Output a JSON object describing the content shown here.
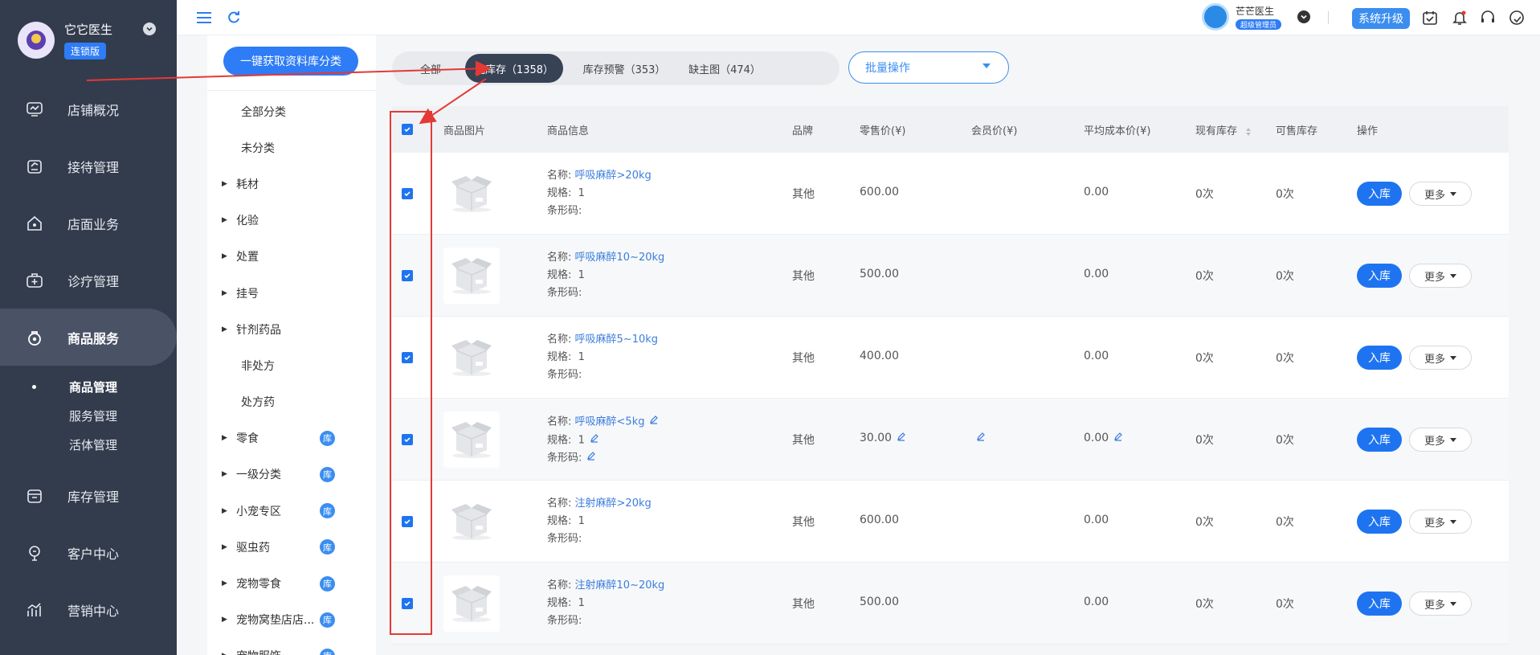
{
  "user": {
    "name": "它它医生",
    "badge": "连锁版"
  },
  "nav": {
    "items": [
      {
        "label": "店铺概况",
        "icon": "monitor-icon"
      },
      {
        "label": "接待管理",
        "icon": "clipboard-icon"
      },
      {
        "label": "店面业务",
        "icon": "shop-icon"
      },
      {
        "label": "诊疗管理",
        "icon": "medical-kit-icon"
      },
      {
        "label": "商品服务",
        "icon": "product-bag-icon"
      },
      {
        "label": "库存管理",
        "icon": "inventory-box-icon"
      },
      {
        "label": "客户中心",
        "icon": "customer-icon"
      },
      {
        "label": "营销中心",
        "icon": "marketing-chart-icon"
      }
    ],
    "sub_items": [
      "商品管理",
      "服务管理",
      "活体管理"
    ]
  },
  "topbar": {
    "clinic_name": "芒芒医生",
    "role": "超级管理员",
    "upgrade": "系统升级"
  },
  "categories": {
    "fetch_button": "一键获取资料库分类",
    "lib_badge": "库",
    "items": [
      {
        "label": "全部分类",
        "type": "leaf"
      },
      {
        "label": "未分类",
        "type": "leaf"
      },
      {
        "label": "耗材",
        "type": "top"
      },
      {
        "label": "化验",
        "type": "top"
      },
      {
        "label": "处置",
        "type": "top"
      },
      {
        "label": "挂号",
        "type": "top"
      },
      {
        "label": "针剂药品",
        "type": "top"
      },
      {
        "label": "非处方",
        "type": "leaf"
      },
      {
        "label": "处方药",
        "type": "leaf"
      },
      {
        "label": "零食",
        "type": "top",
        "lib": true
      },
      {
        "label": "一级分类",
        "type": "top",
        "lib": true
      },
      {
        "label": "小宠专区",
        "type": "top",
        "lib": true
      },
      {
        "label": "驱虫药",
        "type": "top",
        "lib": true
      },
      {
        "label": "宠物零食",
        "type": "top",
        "lib": true
      },
      {
        "label": "宠物窝垫店店...",
        "type": "top",
        "lib": true
      },
      {
        "label": "宠物服饰",
        "type": "top",
        "lib": true
      }
    ]
  },
  "tabs": [
    {
      "label": "全部",
      "active": false
    },
    {
      "label": "无库存（1358）",
      "active": true
    },
    {
      "label": "库存预警（353）",
      "active": false
    },
    {
      "label": "缺主图（474）",
      "active": false
    }
  ],
  "bulk_action": {
    "label": "批量操作"
  },
  "table": {
    "headers": {
      "image": "商品图片",
      "info": "商品信息",
      "brand": "品牌",
      "retail": "零售价(¥)",
      "member": "会员价(¥)",
      "avg_cost": "平均成本价(¥)",
      "stock": "现有库存",
      "sellable": "可售库存",
      "ops": "操作"
    },
    "labels": {
      "name": "名称:",
      "spec": "规格:",
      "barcode": "条形码:"
    },
    "actions": {
      "stock_in": "入库",
      "more": "更多"
    },
    "rows": [
      {
        "name": "呼吸麻醉>20kg",
        "spec": "1",
        "barcode": "",
        "brand": "其他",
        "retail": "600.00",
        "member": "",
        "avg_cost": "0.00",
        "stock": "0次",
        "sellable": "0次",
        "editable": false
      },
      {
        "name": "呼吸麻醉10~20kg",
        "spec": "1",
        "barcode": "",
        "brand": "其他",
        "retail": "500.00",
        "member": "",
        "avg_cost": "0.00",
        "stock": "0次",
        "sellable": "0次",
        "editable": false
      },
      {
        "name": "呼吸麻醉5~10kg",
        "spec": "1",
        "barcode": "",
        "brand": "其他",
        "retail": "400.00",
        "member": "",
        "avg_cost": "0.00",
        "stock": "0次",
        "sellable": "0次",
        "editable": false
      },
      {
        "name": "呼吸麻醉<5kg",
        "spec": "1",
        "barcode": "",
        "brand": "其他",
        "retail": "30.00",
        "member": "",
        "avg_cost": "0.00",
        "stock": "0次",
        "sellable": "0次",
        "editable": true
      },
      {
        "name": "注射麻醉>20kg",
        "spec": "1",
        "barcode": "",
        "brand": "其他",
        "retail": "600.00",
        "member": "",
        "avg_cost": "0.00",
        "stock": "0次",
        "sellable": "0次",
        "editable": false
      },
      {
        "name": "注射麻醉10~20kg",
        "spec": "1",
        "barcode": "",
        "brand": "其他",
        "retail": "500.00",
        "member": "",
        "avg_cost": "0.00",
        "stock": "0次",
        "sellable": "0次",
        "editable": false
      }
    ]
  },
  "colors": {
    "primary": "#1e74f0",
    "nav_bg": "#333c4d",
    "annotation": "#e53935"
  }
}
